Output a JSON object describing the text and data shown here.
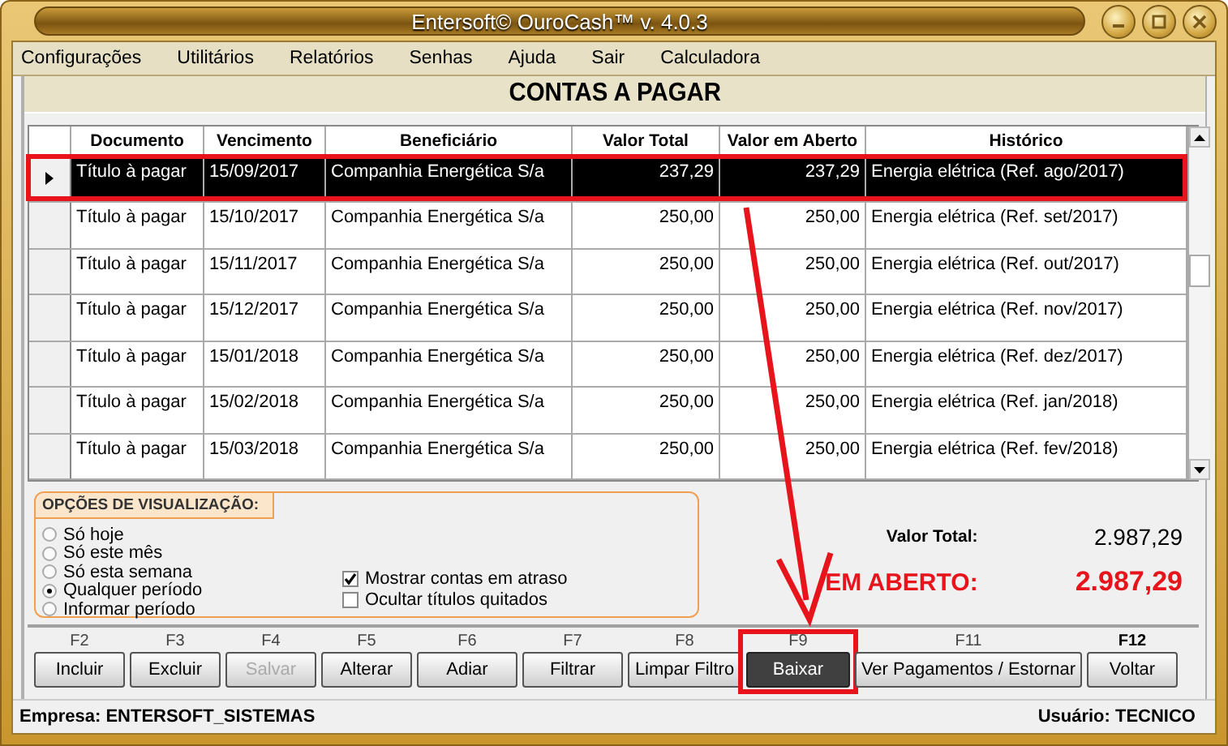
{
  "window": {
    "title": "Entersoft© OuroCash™ v. 4.0.3"
  },
  "menu": [
    "Configurações",
    "Utilitários",
    "Relatórios",
    "Senhas",
    "Ajuda",
    "Sair",
    "Calculadora"
  ],
  "screen_title": "CONTAS A PAGAR",
  "table": {
    "columns": [
      {
        "label": "Documento",
        "kind": "text"
      },
      {
        "label": "Vencimento",
        "kind": "text"
      },
      {
        "label": "Beneficiário",
        "kind": "text"
      },
      {
        "label": "Valor Total",
        "kind": "number"
      },
      {
        "label": "Valor em Aberto",
        "kind": "number"
      },
      {
        "label": "Histórico",
        "kind": "text"
      }
    ],
    "rows": [
      {
        "selected": true,
        "highlighted": true,
        "cells": [
          "Título à pagar",
          "15/09/2017",
          "Companhia Energética S/a",
          "237,29",
          "237,29",
          "Energia elétrica (Ref. ago/2017)"
        ]
      },
      {
        "selected": false,
        "highlighted": false,
        "cells": [
          "Título à pagar",
          "15/10/2017",
          "Companhia Energética S/a",
          "250,00",
          "250,00",
          "Energia elétrica (Ref. set/2017)"
        ]
      },
      {
        "selected": false,
        "highlighted": false,
        "cells": [
          "Título à pagar",
          "15/11/2017",
          "Companhia Energética S/a",
          "250,00",
          "250,00",
          "Energia elétrica (Ref. out/2017)"
        ]
      },
      {
        "selected": false,
        "highlighted": false,
        "cells": [
          "Título à pagar",
          "15/12/2017",
          "Companhia Energética S/a",
          "250,00",
          "250,00",
          "Energia elétrica (Ref. nov/2017)"
        ]
      },
      {
        "selected": false,
        "highlighted": false,
        "cells": [
          "Título à pagar",
          "15/01/2018",
          "Companhia Energética S/a",
          "250,00",
          "250,00",
          "Energia elétrica (Ref. dez/2017)"
        ]
      },
      {
        "selected": false,
        "highlighted": false,
        "cells": [
          "Título à pagar",
          "15/02/2018",
          "Companhia Energética S/a",
          "250,00",
          "250,00",
          "Energia elétrica (Ref. jan/2018)"
        ]
      },
      {
        "selected": false,
        "highlighted": false,
        "cells": [
          "Título à pagar",
          "15/03/2018",
          "Companhia Energética S/a",
          "250,00",
          "250,00",
          "Energia elétrica (Ref. fev/2018)"
        ]
      }
    ]
  },
  "view_options": {
    "title": "OPÇÕES DE VISUALIZAÇÃO:",
    "periods": [
      {
        "label": "Só hoje",
        "selected": false
      },
      {
        "label": "Só este mês",
        "selected": false
      },
      {
        "label": "Só esta semana",
        "selected": false
      },
      {
        "label": "Qualquer período",
        "selected": true
      },
      {
        "label": "Informar período",
        "selected": false
      }
    ],
    "checks": [
      {
        "label": "Mostrar contas em atraso",
        "checked": true
      },
      {
        "label": "Ocultar títulos quitados",
        "checked": false
      }
    ]
  },
  "totals": {
    "total_label": "Valor Total:",
    "total_value": "2.987,29",
    "open_label": "EM ABERTO:",
    "open_value": "2.987,29"
  },
  "buttons": [
    {
      "key": "F2",
      "label": "Incluir",
      "disabled": false,
      "pressed": false,
      "highlighted": false
    },
    {
      "key": "F3",
      "label": "Excluir",
      "disabled": false,
      "pressed": false,
      "highlighted": false
    },
    {
      "key": "F4",
      "label": "Salvar",
      "disabled": true,
      "pressed": false,
      "highlighted": false
    },
    {
      "key": "F5",
      "label": "Alterar",
      "disabled": false,
      "pressed": false,
      "highlighted": false
    },
    {
      "key": "F6",
      "label": "Adiar",
      "disabled": false,
      "pressed": false,
      "highlighted": false
    },
    {
      "key": "F7",
      "label": "Filtrar",
      "disabled": false,
      "pressed": false,
      "highlighted": false
    },
    {
      "key": "F8",
      "label": "Limpar Filtro",
      "disabled": false,
      "pressed": false,
      "highlighted": false
    },
    {
      "key": "F9",
      "label": "Baixar",
      "disabled": false,
      "pressed": true,
      "highlighted": true
    },
    {
      "key": "F11",
      "label": "Ver Pagamentos / Estornar",
      "disabled": false,
      "pressed": false,
      "highlighted": false
    },
    {
      "key": "F12",
      "label": "Voltar",
      "disabled": false,
      "pressed": false,
      "highlighted": false
    }
  ],
  "status_bar": {
    "company": "Empresa: ENTERSOFT_SISTEMAS",
    "user": "Usuário: TECNICO"
  }
}
